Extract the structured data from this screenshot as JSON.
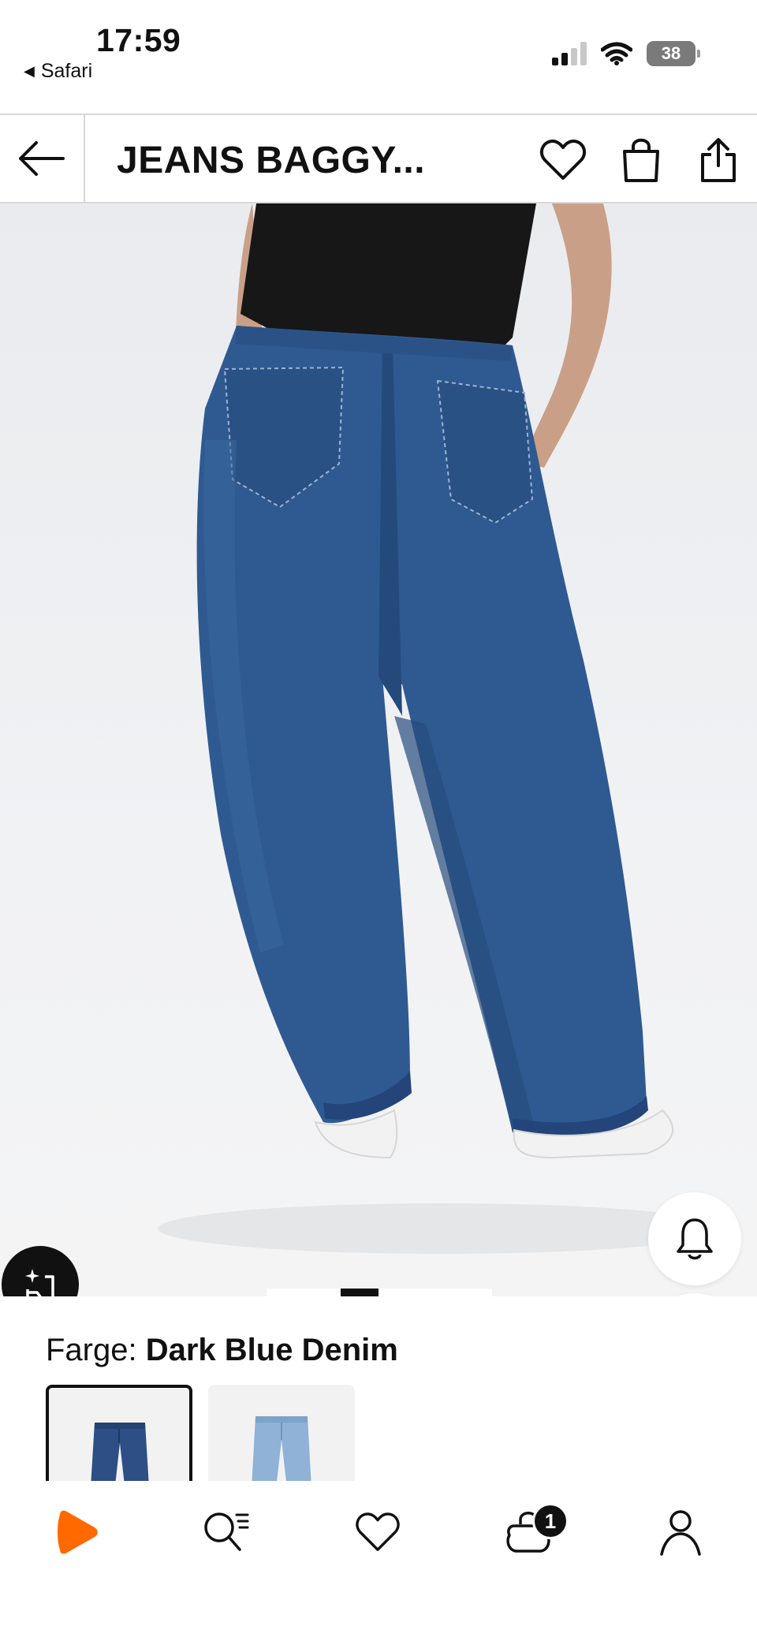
{
  "status_bar": {
    "time": "17:59",
    "back_app": "Safari",
    "battery": "38",
    "icons": [
      "signal-icon",
      "wifi-icon",
      "battery-icon"
    ]
  },
  "header": {
    "title": "JEANS BAGGY...",
    "icons": [
      "back-arrow-icon",
      "heart-icon",
      "shopping-bag-icon",
      "share-icon"
    ]
  },
  "gallery": {
    "image_alt": "Dark blue baggy jeans, back view",
    "pages": 4,
    "current_page": 2,
    "buttons": [
      "ai-assistant-icon",
      "bell-icon",
      "heart-icon",
      "shopping-bag-icon"
    ]
  },
  "color": {
    "label": "Farge:",
    "value": "Dark Blue Denim",
    "swatches": [
      {
        "name": "Dark Blue Denim",
        "selected": true,
        "color": "#2d4f86"
      },
      {
        "name": "Light Blue Denim",
        "selected": false,
        "color": "#8fb2d6"
      }
    ]
  },
  "bottom_nav": {
    "items": [
      "home-icon",
      "search-icon",
      "wishlist-icon",
      "cart-icon",
      "account-icon"
    ],
    "cart_count": "1",
    "brand_color": "#ff6900"
  },
  "colors": {
    "denim": "#2f5a91",
    "denim_dark": "#243f70",
    "top": "#161616",
    "skin": "#caa088",
    "shoe": "#f3f3f3"
  }
}
